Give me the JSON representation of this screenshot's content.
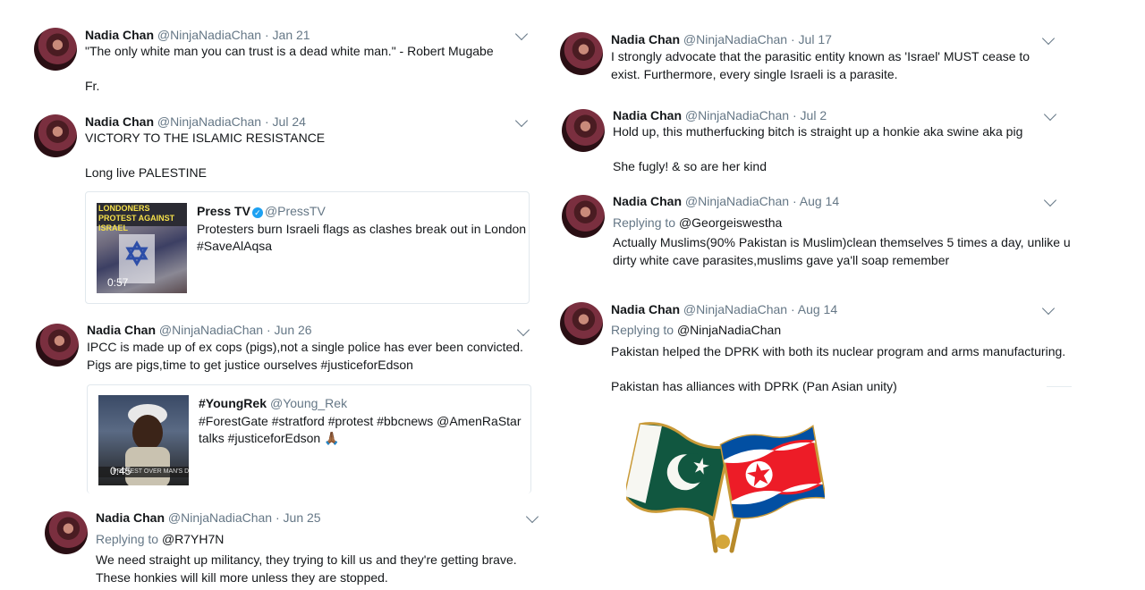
{
  "left": [
    {
      "name": "Nadia Chan",
      "handle": "@NinjaNadiaChan",
      "date": "Jan 21",
      "lines": [
        "\"The only white man you can trust is a dead white man.\" - Robert Mugabe",
        "",
        "Fr."
      ]
    },
    {
      "name": "Nadia Chan",
      "handle": "@NinjaNadiaChan",
      "date": "Jul 24",
      "lines": [
        "VICTORY TO THE ISLAMIC RESISTANCE",
        "",
        "Long live PALESTINE"
      ],
      "card": {
        "thumb_caption": "LONDONERS PROTEST AGAINST ISRAEL",
        "duration": "0:57",
        "title": "Press TV",
        "handle": "@PressTV",
        "verified": true,
        "lines": [
          "Protesters burn Israeli flags as clashes break out in London",
          "#SaveAlAqsa"
        ]
      }
    },
    {
      "name": "Nadia Chan",
      "handle": "@NinjaNadiaChan",
      "date": "Jun 26",
      "lines": [
        "IPCC is made up of ex cops (pigs),not a single police has ever been convicted.",
        "Pigs are pigs,time to get justice ourselves #justiceforEdson"
      ],
      "card": {
        "thumb_caption": "PROTEST OVER MAN'S DEATH",
        "duration": "0:45",
        "title": "#YoungRek",
        "handle": "@Young_Rek",
        "verified": false,
        "lines": [
          "#ForestGate #stratford #protest #bbcnews @AmenRaStar",
          "talks #justiceforEdson 🙏🏾"
        ]
      }
    },
    {
      "name": "Nadia Chan",
      "handle": "@NinjaNadiaChan",
      "date": "Jun 25",
      "replying_label": "Replying to",
      "replying_to": "@R7YH7N",
      "lines": [
        "We need straight up militancy, they trying to kill us and they're getting brave.",
        "These honkies will kill more unless they are stopped."
      ]
    }
  ],
  "right": [
    {
      "name": "Nadia Chan",
      "handle": "@NinjaNadiaChan",
      "date": "Jul 17",
      "lines": [
        "I strongly advocate that the parasitic entity known as 'Israel' MUST cease to",
        "exist. Furthermore, every single Israeli is a parasite."
      ]
    },
    {
      "name": "Nadia Chan",
      "handle": "@NinjaNadiaChan",
      "date": "Jul 2",
      "lines": [
        "Hold up, this mutherfucking bitch is straight up a honkie aka swine aka pig",
        "",
        "She fugly! & so are her kind"
      ]
    },
    {
      "name": "Nadia Chan",
      "handle": "@NinjaNadiaChan",
      "date": "Aug 14",
      "replying_label": "Replying to",
      "replying_to": "@Georgeiswestha",
      "lines": [
        "Actually Muslims(90% Pakistan is Muslim)clean themselves 5 times a day, unlike u",
        "dirty white cave parasites,muslims gave ya'll soap remember"
      ]
    },
    {
      "name": "Nadia Chan",
      "handle": "@NinjaNadiaChan",
      "date": "Aug 14",
      "replying_label": "Replying to",
      "replying_to": "@NinjaNadiaChan",
      "lines": [
        "Pakistan helped the DPRK with both its nuclear program and arms manufacturing.",
        "",
        "Pakistan has alliances with DPRK (Pan Asian unity)"
      ]
    }
  ],
  "colors": {
    "meta": "#657786",
    "link": "#1da1f2",
    "border": "#e1e8ed",
    "pakistan_green": "#115740",
    "dprk_blue": "#024fa2",
    "dprk_red": "#ed1c27"
  },
  "icons": {
    "caret": "chevron-down-icon",
    "verified": "verified-badge-icon",
    "flag_pin": "pakistan-dprk-flag-pin"
  }
}
